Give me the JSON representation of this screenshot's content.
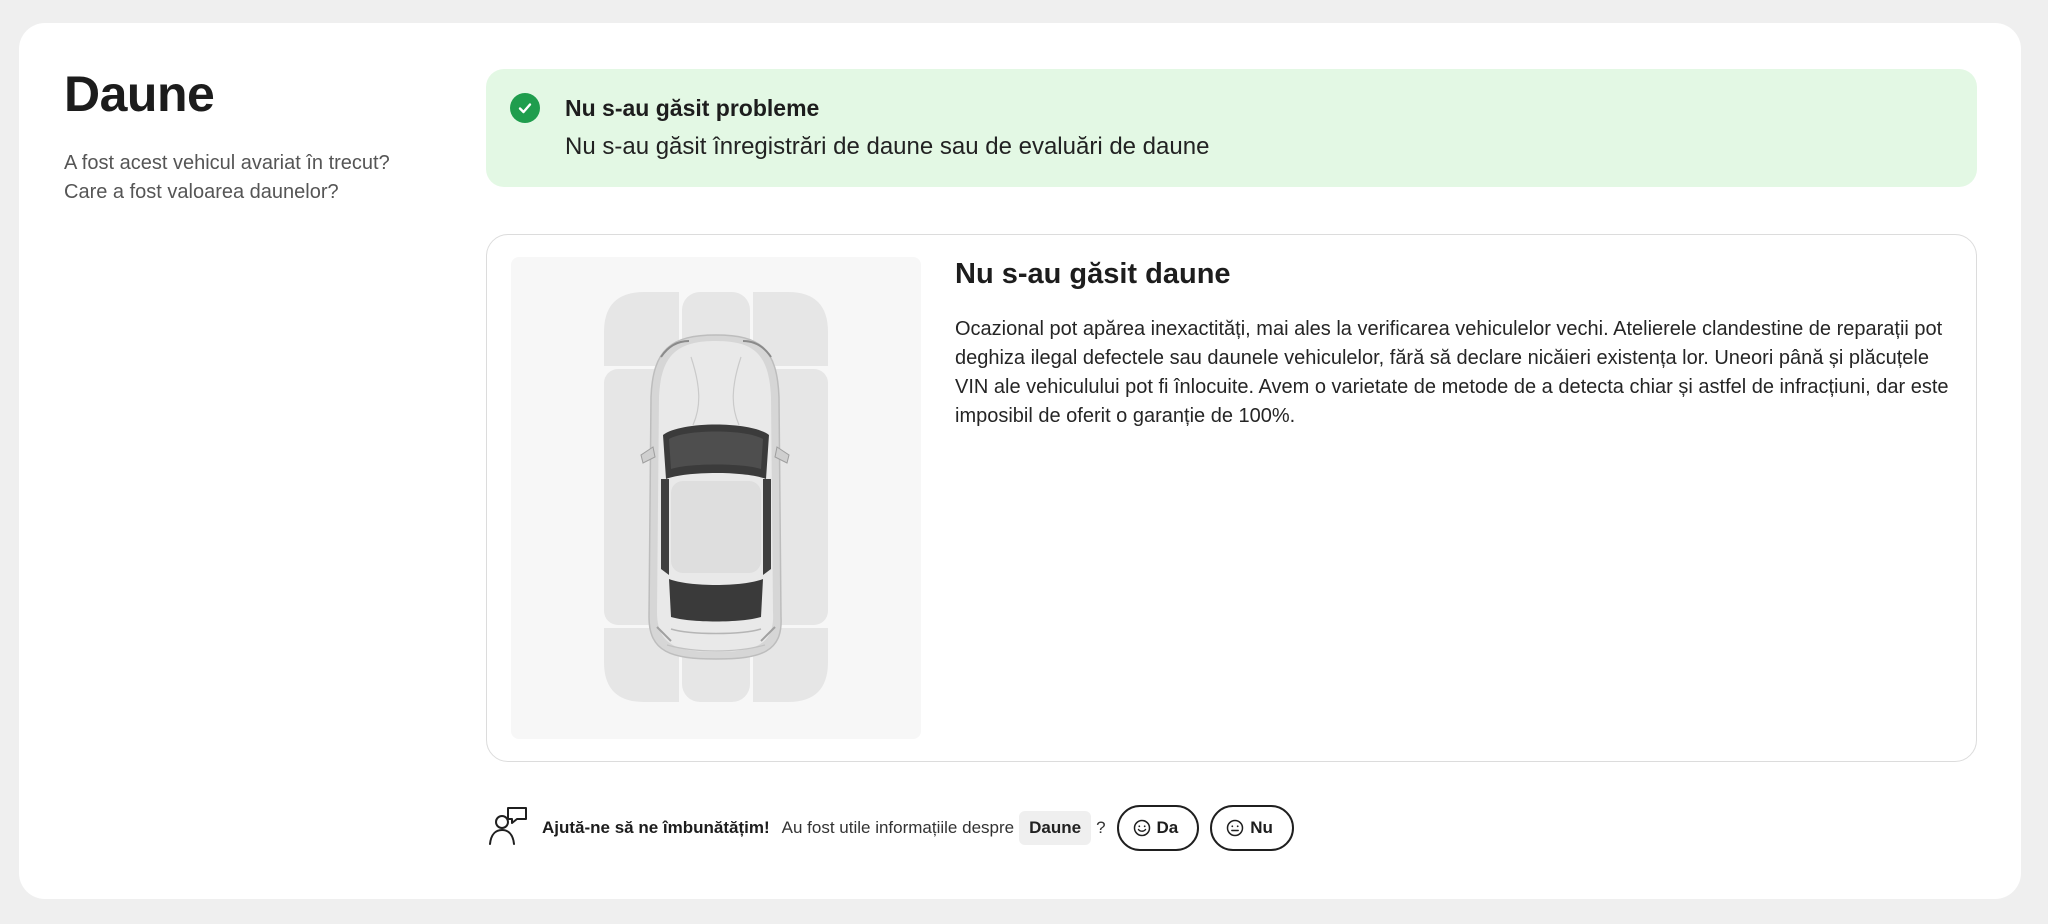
{
  "section": {
    "title": "Daune",
    "subtitle_line1": "A fost acest vehicul avariat în trecut?",
    "subtitle_line2": "Care a fost valoarea daunelor?"
  },
  "alert": {
    "title": "Nu s-au găsit probleme",
    "text": "Nu s-au găsit înregistrări de daune sau de evaluări de daune",
    "color": "#e3f8e4",
    "icon": "check-circle-icon"
  },
  "damage": {
    "title": "Nu s-au găsit daune",
    "text": "Ocazional pot apărea inexactități, mai ales la verificarea vehiculelor vechi. Atelierele clandestine de reparații pot deghiza ilegal defectele sau daunele vehiculelor, fără să declare nicăieri existența lor. Uneori până și plăcuțele VIN ale vehiculului pot fi înlocuite. Avem o varietate de metode de a detecta chiar și astfel de infracțiuni, dar este imposibil de oferit o garanție de 100%."
  },
  "feedback": {
    "prompt": "Ajută-ne să ne îmbunătățim!",
    "question": "Au fost utile informațiile despre",
    "topic": "Daune",
    "question_mark": "?",
    "yes_label": "Da",
    "no_label": "Nu"
  }
}
